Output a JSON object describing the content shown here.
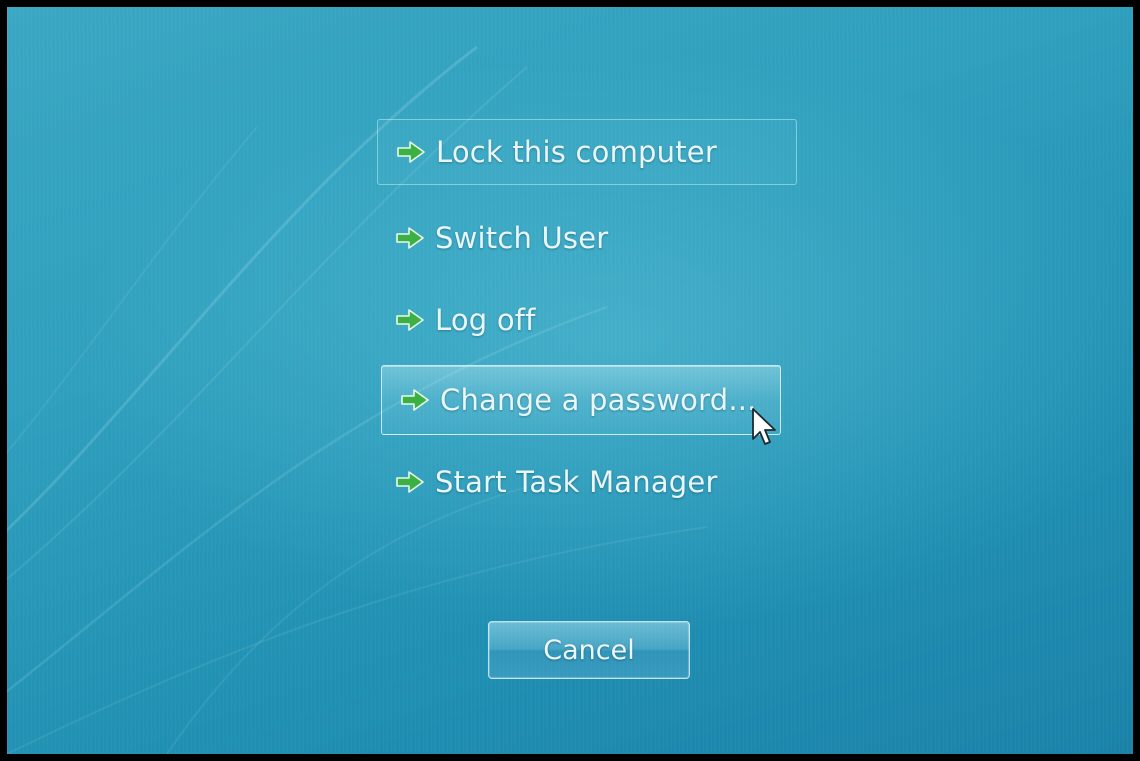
{
  "options": {
    "lock": "Lock this computer",
    "switch_user": "Switch User",
    "log_off": "Log off",
    "change_password": "Change a password...",
    "task_manager": "Start Task Manager"
  },
  "cancel_label": "Cancel",
  "icons": {
    "option_icon": "green-arrow-icon",
    "pointer": "mouse-cursor-icon"
  },
  "colors": {
    "background": "#2e9fbd",
    "arrow": "#3cb043",
    "text": "#e9f6fa"
  },
  "state": {
    "focused_option": "lock",
    "hovered_option": "change_password"
  }
}
